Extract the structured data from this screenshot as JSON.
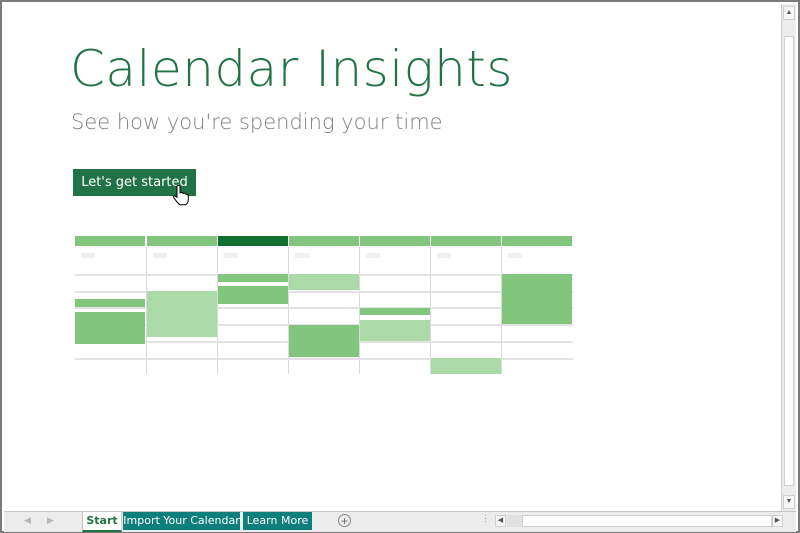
{
  "main": {
    "title": "Calendar Insights",
    "subtitle": "See how you're spending your time",
    "cta_label": "Let's get started"
  },
  "calendar_illustration": {
    "columns": 7,
    "active_column": 2,
    "colors": {
      "header": "#82c57d",
      "header_active": "#0f6e30",
      "event_dark": "#82c57d",
      "event_light": "#acd9a8"
    }
  },
  "sheet_tabs": [
    {
      "label": "Start",
      "active": true
    },
    {
      "label": "Import Your Calendar",
      "active": false
    },
    {
      "label": "Learn More",
      "active": false
    }
  ],
  "controls": {
    "add_sheet": "+",
    "nav_prev": "◀",
    "nav_next": "▶",
    "scroll_up": "▲",
    "scroll_down": "▼",
    "scroll_left": "◀",
    "scroll_right": "▶",
    "splitter": "⋮"
  },
  "colors": {
    "brand": "#217346",
    "tab_teal": "#0e7f7b",
    "subtitle": "#7f7f7f"
  }
}
